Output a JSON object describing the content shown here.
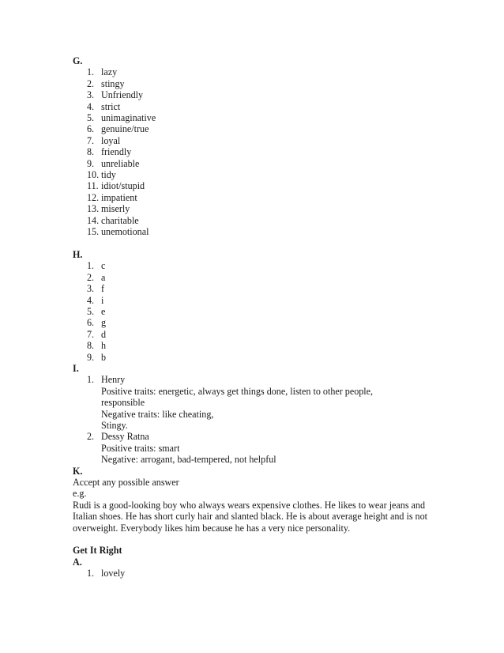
{
  "document": {
    "sections": [
      {
        "id": "section-g",
        "letter": "G.",
        "type": "numbered-list",
        "items": [
          {
            "num": "1.",
            "text": "lazy"
          },
          {
            "num": "2.",
            "text": "stingy"
          },
          {
            "num": "3.",
            "text": "Unfriendly"
          },
          {
            "num": "4.",
            "text": "strict"
          },
          {
            "num": "5.",
            "text": "unimaginative"
          },
          {
            "num": "6.",
            "text": "genuine/true"
          },
          {
            "num": "7.",
            "text": "loyal"
          },
          {
            "num": "8.",
            "text": "friendly"
          },
          {
            "num": "9.",
            "text": "unreliable"
          },
          {
            "num": "10.",
            "text": "tidy"
          },
          {
            "num": "11.",
            "text": "idiot/stupid"
          },
          {
            "num": "12.",
            "text": "impatient"
          },
          {
            "num": "13.",
            "text": "miserly"
          },
          {
            "num": "14.",
            "text": "charitable"
          },
          {
            "num": "15.",
            "text": "unemotional"
          }
        ]
      },
      {
        "id": "section-h",
        "letter": "H.",
        "type": "numbered-list",
        "items": [
          {
            "num": "1.",
            "text": "c"
          },
          {
            "num": "2.",
            "text": "a"
          },
          {
            "num": "3.",
            "text": "f"
          },
          {
            "num": "4.",
            "text": "i"
          },
          {
            "num": "5.",
            "text": "e"
          },
          {
            "num": "6.",
            "text": "g"
          },
          {
            "num": "7.",
            "text": "d"
          },
          {
            "num": "8.",
            "text": "h"
          },
          {
            "num": "9.",
            "text": "b"
          }
        ]
      },
      {
        "id": "section-i",
        "letter": "I.",
        "type": "numbered-list-multiline",
        "items": [
          {
            "num": "1.",
            "text": "Henry",
            "lines": [
              "Positive traits: energetic, always get things done, listen to other people,",
              "responsible",
              "Negative traits: like cheating,",
              "Stingy."
            ]
          },
          {
            "num": "2.",
            "text": "Dessy Ratna",
            "lines": [
              "Positive traits: smart",
              "Negative: arrogant, bad-tempered, not helpful"
            ]
          }
        ]
      },
      {
        "id": "section-k",
        "letter": "K.",
        "type": "paragraphs",
        "lines": [
          "Accept any possible answer",
          "e.g."
        ],
        "paragraph": "Rudi is a good-looking boy who always wears expensive clothes. He likes to wear jeans and Italian shoes. He has short curly hair and slanted black. He is about average height and is not overweight. Everybody likes him because he has a very nice personality."
      }
    ],
    "get_it_right": {
      "id": "get-it-right",
      "heading": "Get It Right",
      "letter": "A.",
      "items": [
        {
          "num": "1.",
          "text": "lovely"
        }
      ]
    }
  }
}
